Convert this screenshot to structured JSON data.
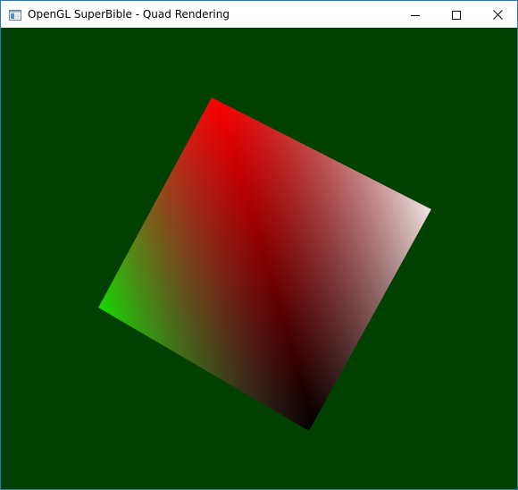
{
  "window": {
    "title": "OpenGL SuperBible - Quad Rendering",
    "background_color": "#004000"
  },
  "icons": {
    "app": "app-window-icon",
    "minimize": "minimize-icon",
    "maximize": "maximize-icon",
    "close": "close-icon"
  },
  "quad": {
    "vertex_colors": {
      "top": "#ff0000",
      "right": "#ffffff",
      "bottom": "#000000",
      "left": "#00ff00"
    }
  }
}
